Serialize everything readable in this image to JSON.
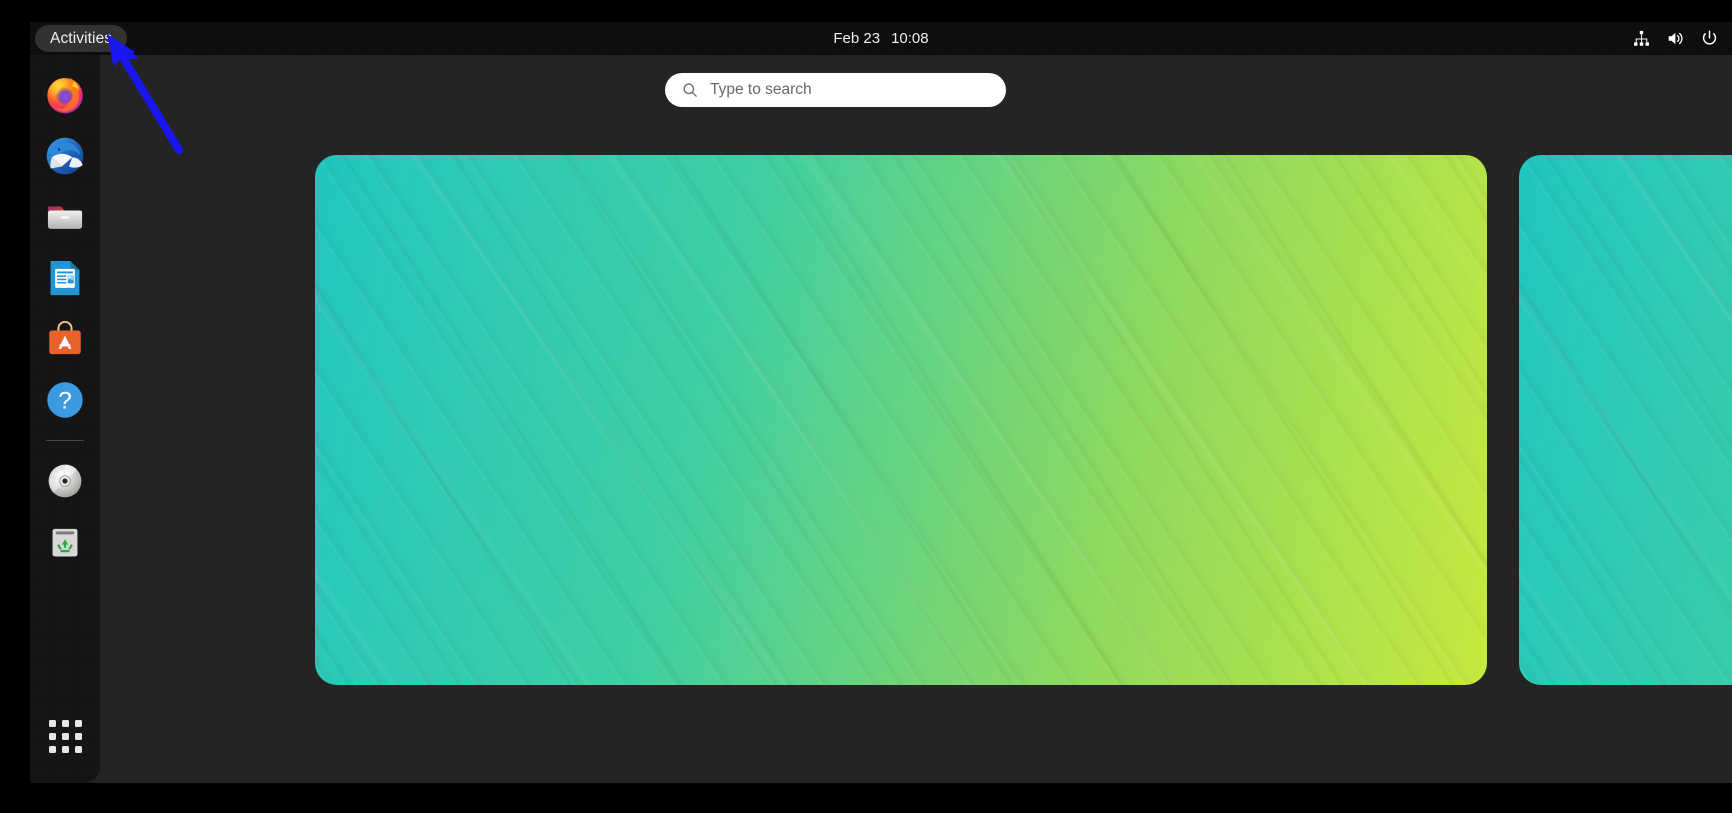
{
  "desktop": {
    "environment": "GNOME Shell Activities Overview",
    "background_color": "#242424",
    "letterbox_color": "#000000"
  },
  "topbar": {
    "background_color": "#0e0e0e",
    "activities_label": "Activities",
    "clock": {
      "date": "Feb 23",
      "time": "10:08"
    },
    "status_icons": [
      {
        "name": "network-wired-icon",
        "label": "Wired Network"
      },
      {
        "name": "volume-icon",
        "label": "Volume"
      },
      {
        "name": "power-icon",
        "label": "Power Off / Log Out"
      }
    ]
  },
  "search": {
    "placeholder": "Type to search",
    "value": "",
    "icon": "search-icon",
    "background_color": "#ffffff",
    "text_color": "#686868"
  },
  "dock": {
    "background_color": "#151515",
    "items": [
      {
        "name": "dock-item-firefox",
        "label": "Firefox",
        "icon": "firefox-icon"
      },
      {
        "name": "dock-item-thunderbird",
        "label": "Thunderbird Mail",
        "icon": "thunderbird-icon"
      },
      {
        "name": "dock-item-files",
        "label": "Files",
        "icon": "files-folder-icon"
      },
      {
        "name": "dock-item-libreoffice",
        "label": "LibreOffice Writer",
        "icon": "libreoffice-writer-icon"
      },
      {
        "name": "dock-item-ubuntu-software",
        "label": "Ubuntu Software",
        "icon": "ubuntu-software-icon"
      },
      {
        "name": "dock-item-help",
        "label": "Help",
        "icon": "help-question-icon"
      }
    ],
    "mounted_items": [
      {
        "name": "dock-item-cd-drive",
        "label": "CD/DVD Drive",
        "icon": "optical-disc-icon"
      },
      {
        "name": "dock-item-trash",
        "label": "Trash",
        "icon": "trash-recycle-icon"
      }
    ],
    "app_grid": {
      "name": "app-grid-button",
      "label": "Show Applications",
      "icon": "grid-dots-icon"
    }
  },
  "workspaces": [
    {
      "name": "workspace-current",
      "label": "Workspace 1",
      "selected": true,
      "wallpaper": {
        "description": "Diagonal striped gradient wallpaper",
        "colors": [
          "#23c6bd",
          "#3ecfa7",
          "#8bd862",
          "#c3e83f"
        ]
      }
    },
    {
      "name": "workspace-next",
      "label": "Workspace 2",
      "selected": false,
      "wallpaper": {
        "description": "Diagonal striped gradient wallpaper",
        "colors": [
          "#23c6bd",
          "#3ecfa7",
          "#8bd862",
          "#c3e83f"
        ]
      }
    }
  ],
  "annotation": {
    "name": "annotation-arrow",
    "type": "arrow",
    "color": "#1a16f0",
    "points_to": "Activities"
  }
}
